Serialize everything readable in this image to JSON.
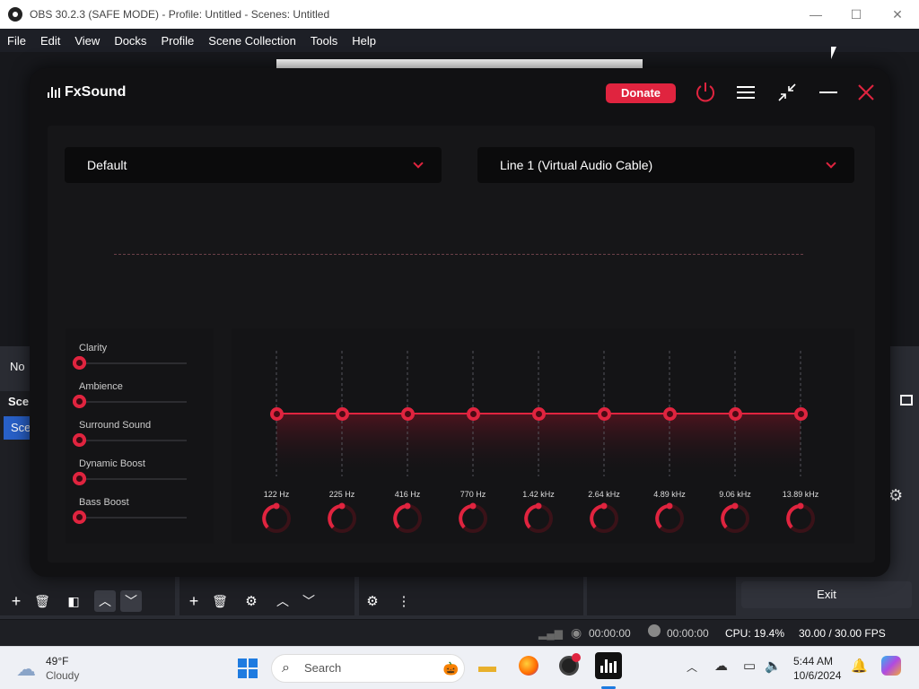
{
  "obs": {
    "title": "OBS 30.2.3 (SAFE MODE) - Profile: Untitled - Scenes: Untitled",
    "menu": [
      "File",
      "Edit",
      "View",
      "Docks",
      "Profile",
      "Scene Collection",
      "Tools",
      "Help"
    ],
    "left_panel_partial": "No",
    "scenes_header_partial": "Sce",
    "scene_item_partial": "Sce",
    "exit_label": "Exit",
    "status": {
      "stream_time": "00:00:00",
      "rec_time": "00:00:00",
      "cpu": "CPU: 19.4%",
      "fps": "30.00 / 30.00 FPS"
    }
  },
  "fxsound": {
    "app_name": "FxSound",
    "donate_label": "Donate",
    "preset": "Default",
    "output_device": "Line 1 (Virtual Audio Cable)",
    "effects": [
      {
        "label": "Clarity",
        "value": 0
      },
      {
        "label": "Ambience",
        "value": 0
      },
      {
        "label": "Surround Sound",
        "value": 0
      },
      {
        "label": "Dynamic Boost",
        "value": 0
      },
      {
        "label": "Bass Boost",
        "value": 0
      }
    ],
    "eq_bands": [
      {
        "freq": "122 Hz"
      },
      {
        "freq": "225 Hz"
      },
      {
        "freq": "416 Hz"
      },
      {
        "freq": "770 Hz"
      },
      {
        "freq": "1.42 kHz"
      },
      {
        "freq": "2.64 kHz"
      },
      {
        "freq": "4.89 kHz"
      },
      {
        "freq": "9.06 kHz"
      },
      {
        "freq": "13.89 kHz"
      }
    ],
    "accent_color": "#e0243f"
  },
  "taskbar": {
    "weather_temp": "49°F",
    "weather_desc": "Cloudy",
    "search_placeholder": "Search",
    "time": "5:44 AM",
    "date": "10/6/2024"
  }
}
